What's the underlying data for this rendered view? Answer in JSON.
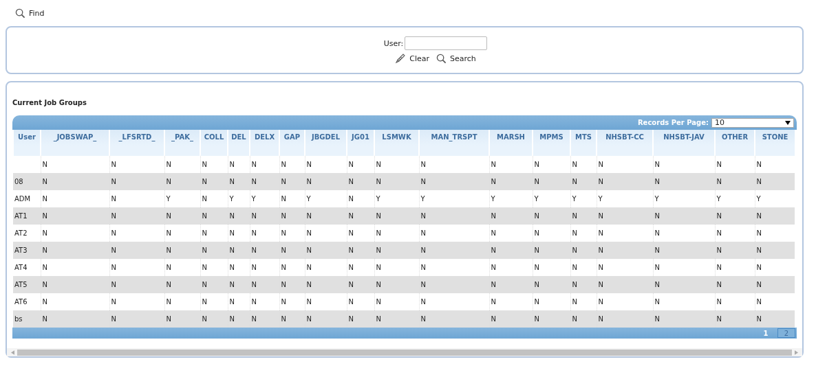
{
  "toolbar": {
    "find": "Find"
  },
  "filter": {
    "label": "User:",
    "clear": "Clear",
    "search": "Search"
  },
  "panel": {
    "title": "Current Job Groups",
    "records_label": "Records Per Page:",
    "records_value": "10"
  },
  "table": {
    "columns": [
      "User",
      "_JOBSWAP_",
      "_LFSRTD_",
      "_PAK_",
      "COLL",
      "DEL",
      "DELX",
      "GAP",
      "JBGDEL",
      "JG01",
      "LSMWK",
      "MAN_TRSPT",
      "MARSH",
      "MPMS",
      "MTS",
      "NHSBT-CC",
      "NHSBT-JAV",
      "OTHER",
      "STONE"
    ],
    "rows": [
      {
        "values": [
          "N",
          "N",
          "N",
          "N",
          "N",
          "N",
          "N",
          "N",
          "N",
          "N",
          "N",
          "N",
          "N",
          "N",
          "N",
          "N",
          "N",
          "N"
        ]
      },
      {
        "user": "08",
        "values": [
          "N",
          "N",
          "N",
          "N",
          "N",
          "N",
          "N",
          "N",
          "N",
          "N",
          "N",
          "N",
          "N",
          "N",
          "N",
          "N",
          "N",
          "N"
        ]
      },
      {
        "user": "ADM",
        "values": [
          "N",
          "N",
          "Y",
          "N",
          "Y",
          "Y",
          "N",
          "Y",
          "N",
          "Y",
          "Y",
          "Y",
          "Y",
          "Y",
          "Y",
          "Y",
          "Y",
          "Y"
        ]
      },
      {
        "user": "AT1",
        "values": [
          "N",
          "N",
          "N",
          "N",
          "N",
          "N",
          "N",
          "N",
          "N",
          "N",
          "N",
          "N",
          "N",
          "N",
          "N",
          "N",
          "N",
          "N"
        ]
      },
      {
        "user": "AT2",
        "values": [
          "N",
          "N",
          "N",
          "N",
          "N",
          "N",
          "N",
          "N",
          "N",
          "N",
          "N",
          "N",
          "N",
          "N",
          "N",
          "N",
          "N",
          "N"
        ]
      },
      {
        "user": "AT3",
        "values": [
          "N",
          "N",
          "N",
          "N",
          "N",
          "N",
          "N",
          "N",
          "N",
          "N",
          "N",
          "N",
          "N",
          "N",
          "N",
          "N",
          "N",
          "N"
        ]
      },
      {
        "user": "AT4",
        "values": [
          "N",
          "N",
          "N",
          "N",
          "N",
          "N",
          "N",
          "N",
          "N",
          "N",
          "N",
          "N",
          "N",
          "N",
          "N",
          "N",
          "N",
          "N"
        ]
      },
      {
        "user": "AT5",
        "values": [
          "N",
          "N",
          "N",
          "N",
          "N",
          "N",
          "N",
          "N",
          "N",
          "N",
          "N",
          "N",
          "N",
          "N",
          "N",
          "N",
          "N",
          "N"
        ]
      },
      {
        "user": "AT6",
        "values": [
          "N",
          "N",
          "N",
          "N",
          "N",
          "N",
          "N",
          "N",
          "N",
          "N",
          "N",
          "N",
          "N",
          "N",
          "N",
          "N",
          "N",
          "N"
        ]
      },
      {
        "user": "bs",
        "values": [
          "N",
          "N",
          "N",
          "N",
          "N",
          "N",
          "N",
          "N",
          "N",
          "N",
          "N",
          "N",
          "N",
          "N",
          "N",
          "N",
          "N",
          "N"
        ]
      }
    ]
  },
  "pages": [
    {
      "label": "1",
      "selected": true
    },
    {
      "label": "2",
      "selected": false
    }
  ]
}
